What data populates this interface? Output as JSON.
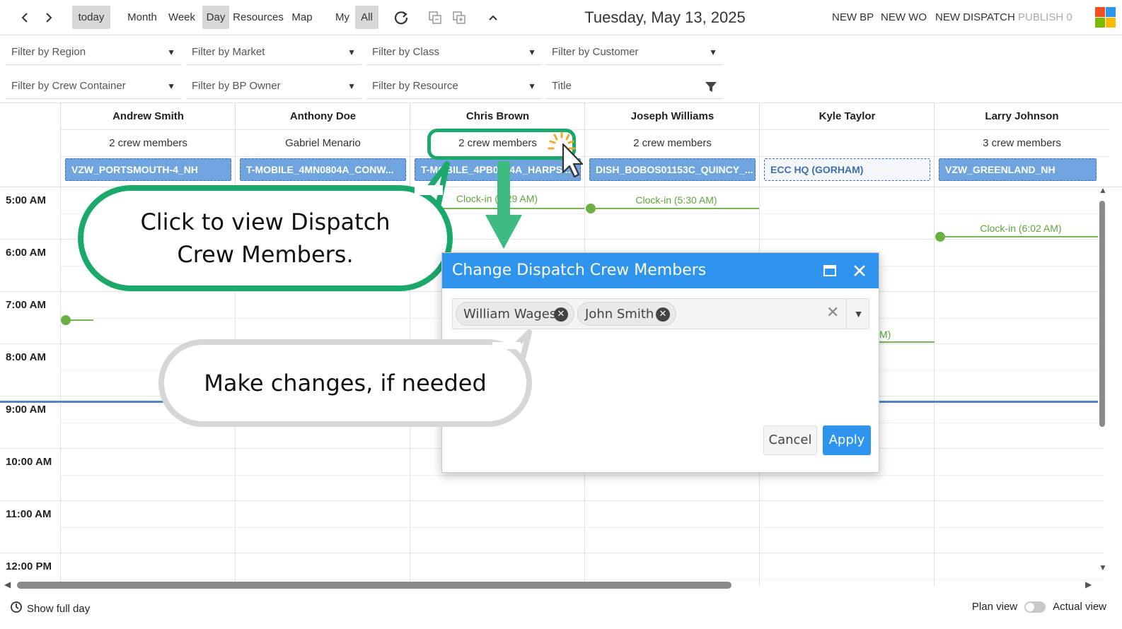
{
  "toolbar": {
    "today": "today",
    "month": "Month",
    "week": "Week",
    "day": "Day",
    "resources": "Resources",
    "map": "Map",
    "my": "My",
    "all": "All",
    "date": "Tuesday, May 13, 2025",
    "new_bp": "NEW BP",
    "new_wo": "NEW WO",
    "new_dispatch": "NEW DISPATCH",
    "publish": "PUBLISH 0"
  },
  "filters": {
    "region": "Filter by Region",
    "market": "Filter by Market",
    "class": "Filter by Class",
    "customer": "Filter by Customer",
    "crew_container": "Filter by Crew Container",
    "bp_owner": "Filter by BP Owner",
    "resource": "Filter by Resource",
    "title": "Title"
  },
  "resources": [
    {
      "name": "Andrew Smith",
      "crew": "2 crew members",
      "tag": "VZW_PORTSMOUTH-4_NH"
    },
    {
      "name": "Anthony Doe",
      "crew": "Gabriel Menario",
      "tag": "T-MOBILE_4MN0804A_CONW..."
    },
    {
      "name": "Chris Brown",
      "crew": "2 crew members",
      "tag": "T-MOBILE_4PB0504A_HARPS..."
    },
    {
      "name": "Joseph Williams",
      "crew": "2 crew members",
      "tag": "DISH_BOBOS01153C_QUINCY_..."
    },
    {
      "name": "Kyle Taylor",
      "crew": "",
      "tag": "ECC HQ (GORHAM)"
    },
    {
      "name": "Larry Johnson",
      "crew": "3 crew members",
      "tag": "VZW_GREENLAND_NH"
    }
  ],
  "times": [
    "5:00 AM",
    "6:00 AM",
    "7:00 AM",
    "8:00 AM",
    "9:00 AM",
    "10:00 AM",
    "11:00 AM",
    "12:00 PM"
  ],
  "clockins": {
    "chris": "Clock-in (5:29 AM)",
    "joseph": "Clock-in (5:30 AM)",
    "larry": "Clock-in (6:02 AM)",
    "kyle_partial": "M)"
  },
  "callouts": {
    "click": "Click to view Dispatch Crew Members.",
    "changes": "Make changes, if needed"
  },
  "modal": {
    "title": "Change Dispatch Crew Members",
    "members": [
      "William Wages",
      "John Smith"
    ],
    "cancel": "Cancel",
    "apply": "Apply"
  },
  "footer": {
    "show_full_day": "Show full day",
    "plan_view": "Plan view",
    "actual_view": "Actual view"
  }
}
